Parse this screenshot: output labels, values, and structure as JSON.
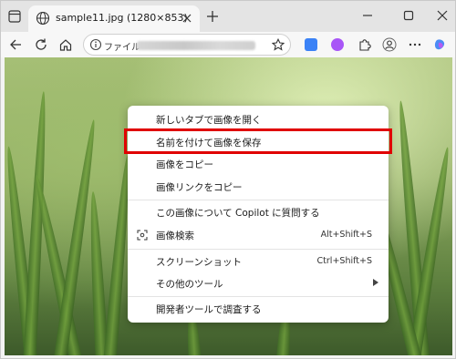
{
  "tab": {
    "title": "sample11.jpg (1280×853)",
    "favicon": "globe-icon"
  },
  "toolbar": {
    "address_scheme_label": "ファイル",
    "address_path_obscured": true
  },
  "context_menu": {
    "items": [
      {
        "label": "新しいタブで画像を開く",
        "shortcut": "",
        "icon": "",
        "has_submenu": false
      },
      {
        "label": "名前を付けて画像を保存",
        "shortcut": "",
        "icon": "",
        "has_submenu": false,
        "highlighted": true
      },
      {
        "label": "画像をコピー",
        "shortcut": "",
        "icon": "",
        "has_submenu": false
      },
      {
        "label": "画像リンクをコピー",
        "shortcut": "",
        "icon": "",
        "has_submenu": false
      },
      {
        "label": "この画像について Copilot に質問する",
        "shortcut": "",
        "icon": "",
        "has_submenu": false
      },
      {
        "label": "画像検索",
        "shortcut": "Alt+Shift+S",
        "icon": "visual-search-icon",
        "has_submenu": false
      },
      {
        "label": "スクリーンショット",
        "shortcut": "Ctrl+Shift+S",
        "icon": "",
        "has_submenu": false
      },
      {
        "label": "その他のツール",
        "shortcut": "",
        "icon": "",
        "has_submenu": true
      },
      {
        "label": "開発者ツールで調査する",
        "shortcut": "",
        "icon": "",
        "has_submenu": false
      }
    ]
  },
  "colors": {
    "highlight_border": "#e00000",
    "tabstrip_bg": "#e4e4e4",
    "toolbar_bg": "#f7f7f7",
    "ext_blue": "#3b82f6",
    "ext_purple": "#a855f7"
  }
}
